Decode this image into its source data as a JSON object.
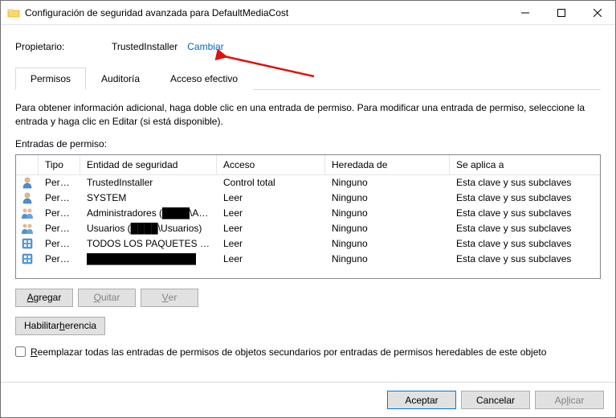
{
  "title": "Configuración de seguridad avanzada para DefaultMediaCost",
  "owner": {
    "label": "Propietario:",
    "value": "TrustedInstaller",
    "change": "Cambiar"
  },
  "tabs": [
    {
      "label": "Permisos",
      "active": true
    },
    {
      "label": "Auditoría",
      "active": false
    },
    {
      "label": "Acceso efectivo",
      "active": false
    }
  ],
  "info_text": "Para obtener información adicional, haga doble clic en una entrada de permiso. Para modificar una entrada de permiso, seleccione la entrada y haga clic en Editar (si está disponible).",
  "entries_label": "Entradas de permiso:",
  "columns": {
    "type": "Tipo",
    "principal": "Entidad de seguridad",
    "access": "Acceso",
    "inherited": "Heredada de",
    "applies": "Se aplica a"
  },
  "rows": [
    {
      "icon": "user",
      "type": "Perm...",
      "principal": "TrustedInstaller",
      "access": "Control total",
      "inherited": "Ninguno",
      "applies": "Esta clave y sus subclaves"
    },
    {
      "icon": "user",
      "type": "Perm...",
      "principal": "SYSTEM",
      "access": "Leer",
      "inherited": "Ninguno",
      "applies": "Esta clave y sus subclaves"
    },
    {
      "icon": "group",
      "type": "Perm...",
      "principal": "Administradores (████\\Adm...",
      "access": "Leer",
      "inherited": "Ninguno",
      "applies": "Esta clave y sus subclaves"
    },
    {
      "icon": "group",
      "type": "Perm...",
      "principal": "Usuarios (████\\Usuarios)",
      "access": "Leer",
      "inherited": "Ninguno",
      "applies": "Esta clave y sus subclaves"
    },
    {
      "icon": "pkg",
      "type": "Perm...",
      "principal": "TODOS LOS PAQUETES DE AP...",
      "access": "Leer",
      "inherited": "Ninguno",
      "applies": "Esta clave y sus subclaves"
    },
    {
      "icon": "pkg",
      "type": "Perm...",
      "principal": "████████████████",
      "access": "Leer",
      "inherited": "Ninguno",
      "applies": "Esta clave y sus subclaves"
    }
  ],
  "buttons": {
    "add": "Agregar",
    "remove": "Quitar",
    "view": "Ver",
    "enable_inherit": "Habilitar herencia",
    "replace_check": "Reemplazar todas las entradas de permisos de objetos secundarios por entradas de permisos heredables de este objeto",
    "ok": "Aceptar",
    "cancel": "Cancelar",
    "apply": "Aplicar"
  },
  "underline": {
    "add": "A",
    "remove": "Q",
    "view": "V",
    "enable": "h",
    "replace": "R",
    "apply": "l"
  }
}
